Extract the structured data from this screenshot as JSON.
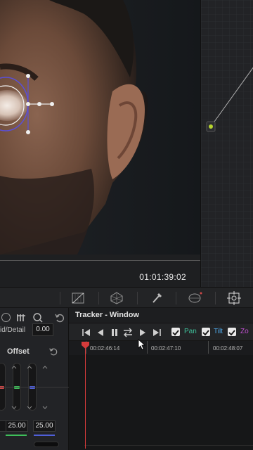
{
  "viewer": {
    "timecode": "01:01:39:02"
  },
  "toolbar": {
    "icons": [
      "curves-icon",
      "fx-icon",
      "eyedropper-icon",
      "window-icon",
      "tracker-icon"
    ]
  },
  "left_panel": {
    "mid_detail_label": "id/Detail",
    "mid_detail_value": "0.00",
    "offset_label": "Offset",
    "values": [
      "25.00",
      "25.00"
    ],
    "wheel_colors": [
      "#d04848",
      "#3fbf5a",
      "#4f5fd8"
    ]
  },
  "tracker": {
    "title": "Tracker - Window",
    "pan_label": "Pan",
    "tilt_label": "Tilt",
    "zoom_label": "Zo",
    "pan_color": "#3fbf9a",
    "tilt_color": "#4fa8e8",
    "zoom_color": "#c04fd0",
    "timecodes": [
      "00:02:46:14",
      "00:02:47:10",
      "00:02:48:07"
    ]
  }
}
